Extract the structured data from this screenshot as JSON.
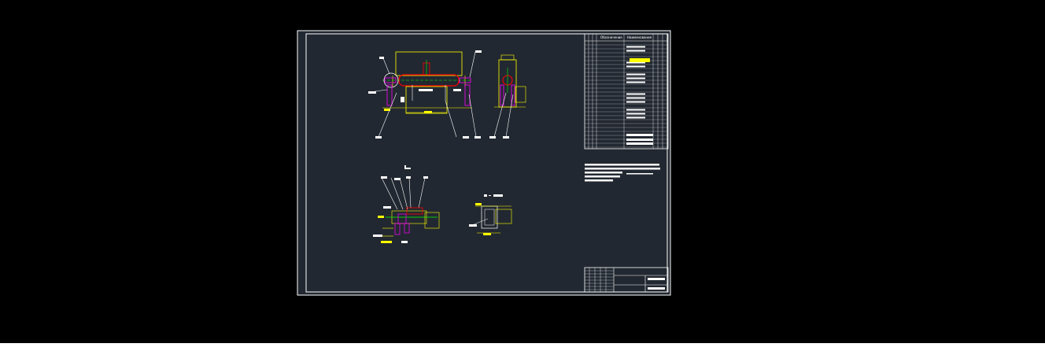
{
  "colors": {
    "viewer_bg": "#000000",
    "sheet_bg": "#222831",
    "frame": "#ffffff",
    "geometry": "#ffffff",
    "dimension": "#ffff00",
    "vessel": "#ff0000",
    "flange": "#ff00ff",
    "axis": "#00ff00"
  },
  "bom": {
    "col_designation": "Обозначение",
    "col_name": "Наименование"
  }
}
